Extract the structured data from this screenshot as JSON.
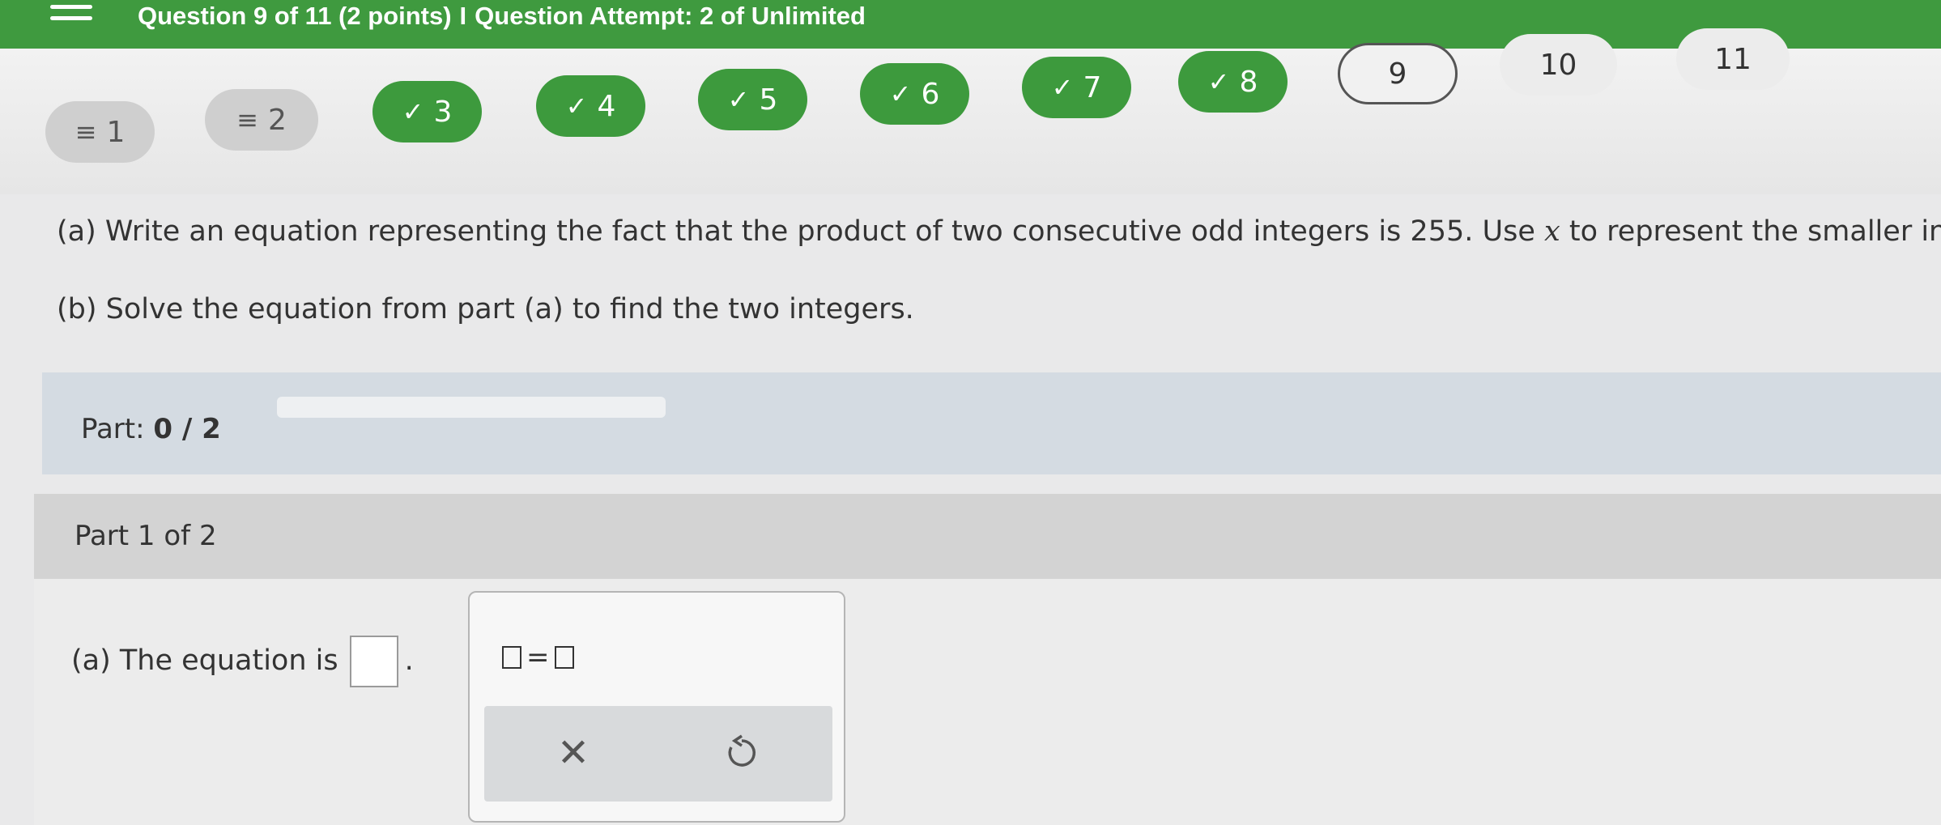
{
  "topbar": {
    "title": "Question 9 of 11 (2 points)",
    "separator": "I",
    "attempt": "Question Attempt: 2 of Unlimited"
  },
  "questions": [
    {
      "label": "1",
      "state": "partial",
      "mark": "≡"
    },
    {
      "label": "2",
      "state": "partial",
      "mark": "≡"
    },
    {
      "label": "3",
      "state": "done",
      "mark": "✓"
    },
    {
      "label": "4",
      "state": "done",
      "mark": "✓"
    },
    {
      "label": "5",
      "state": "done",
      "mark": "✓"
    },
    {
      "label": "6",
      "state": "done",
      "mark": "✓"
    },
    {
      "label": "7",
      "state": "done",
      "mark": "✓"
    },
    {
      "label": "8",
      "state": "done",
      "mark": "✓"
    },
    {
      "label": "9",
      "state": "current",
      "mark": ""
    },
    {
      "label": "10",
      "state": "todo",
      "mark": ""
    },
    {
      "label": "11",
      "state": "todo",
      "mark": ""
    }
  ],
  "prompt": {
    "a_prefix": "(a) Write an equation representing the fact that the product of two consecutive odd integers is 255. Use",
    "a_var": "x",
    "a_suffix": "to represent the smaller integer.",
    "b": "(b) Solve the equation from part (a) to find the two integers."
  },
  "part_progress": {
    "label": "Part:",
    "value": "0 / 2",
    "fraction": 0
  },
  "part_header": "Part 1 of 2",
  "answer": {
    "text": "(a) The equation is",
    "dot": "."
  },
  "palette": {
    "template_equals": "=",
    "clear_icon": "close-icon",
    "undo_icon": "undo-icon"
  },
  "colors": {
    "topbar": "#3f9a3f",
    "done": "#3d9a3d",
    "partial": "#cfcfcf"
  }
}
